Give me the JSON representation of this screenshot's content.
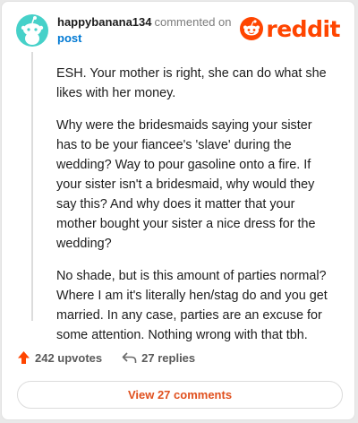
{
  "comment": {
    "username": "happybanana134",
    "action": "commented on",
    "target": "post",
    "paragraphs": [
      "ESH. Your mother is right, she can do what she likes with her money.",
      "Why were the bridesmaids saying your sister has to be your fiancee's 'slave' during the wedding? Way to pour gasoline onto a fire. If your sister isn't a bridesmaid, why would they say this? And why does it matter that your mother bought your sister a nice dress for the wedding?",
      "No shade, but is this amount of parties normal? Where I am it's literally hen/stag do and you get married. In any case, parties are an excuse for some attention. Nothing wrong with that tbh."
    ]
  },
  "brand": {
    "name": "reddit",
    "color": "#ff4500"
  },
  "footer": {
    "upvotes": "242 upvotes",
    "replies": "27 replies",
    "view_button": "View 27 comments"
  },
  "icons": {
    "avatar": "snoo-avatar-icon",
    "logo": "reddit-snoo-logo-icon",
    "upvote": "upvote-arrow-icon",
    "reply": "reply-arrow-icon"
  },
  "colors": {
    "avatar_bg": "#46d1c9",
    "link": "#0079d3",
    "upvote": "#ff4500",
    "button_text": "#e0501e"
  }
}
